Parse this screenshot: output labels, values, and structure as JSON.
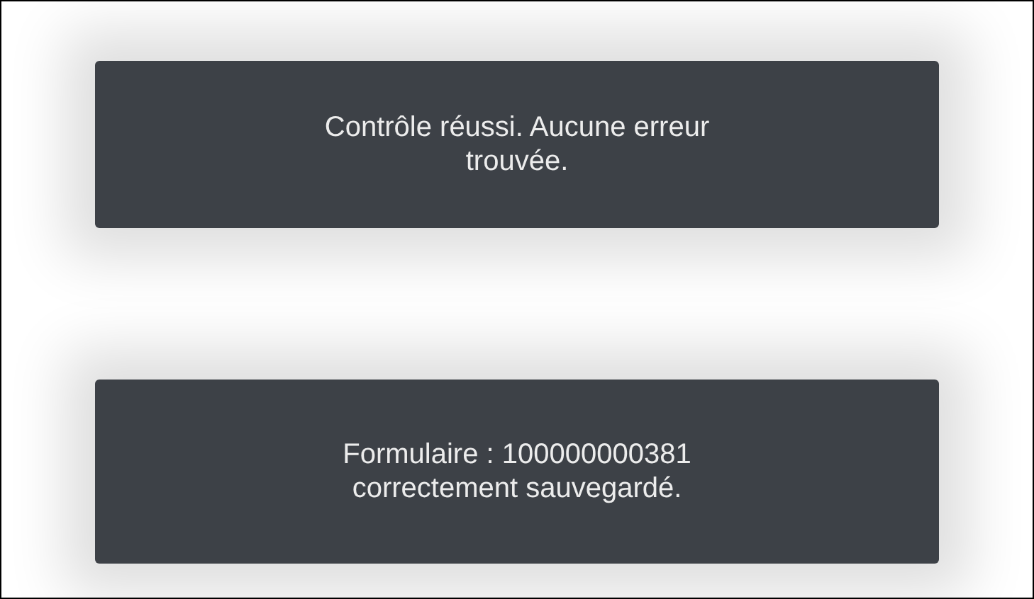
{
  "toasts": [
    {
      "message": "Contrôle réussi. Aucune erreur trouvée."
    },
    {
      "message": "Formulaire : 100000000381 correctement sauvegardé."
    }
  ]
}
